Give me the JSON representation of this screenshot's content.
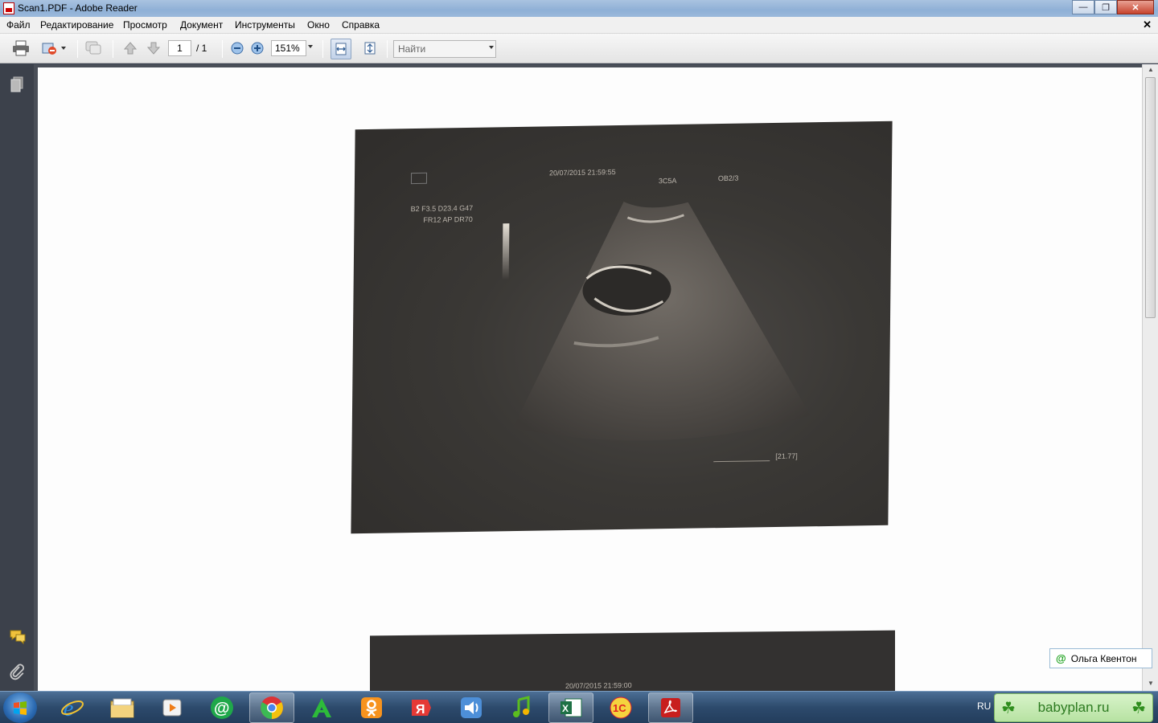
{
  "window": {
    "title": "Scan1.PDF - Adobe Reader",
    "minimize": "—",
    "maximize": "❐",
    "close": "✕"
  },
  "menu": {
    "items": [
      "Файл",
      "Редактирование",
      "Просмотр",
      "Документ",
      "Инструменты",
      "Окно",
      "Справка"
    ],
    "doc_close": "✕"
  },
  "toolbar": {
    "page_current": "1",
    "page_total": "/ 1",
    "zoom": "151%",
    "find_placeholder": "Найти"
  },
  "document": {
    "scan1": {
      "datetime": "20/07/2015   21:59:55",
      "probe": "3C5A",
      "preset": "OB2/3",
      "params_line1": "B2   F3.5  D23.4   G47",
      "params_line2": "FR12  AP   DR70",
      "measure": "[21.77]"
    },
    "scan2": {
      "datetime": "20/07/2015   21:59:00"
    }
  },
  "chat": {
    "name": "Ольга Квентон",
    "icon": "@"
  },
  "taskbar": {
    "lang": "RU",
    "babyplan": "babyplan.ru",
    "apps": [
      "internet-explorer",
      "file-explorer",
      "media-player",
      "mail-agent",
      "chrome",
      "acrobat-green",
      "odnoklassniki",
      "yandex-browser",
      "audio",
      "music",
      "excel",
      "1c",
      "adobe-reader"
    ]
  }
}
